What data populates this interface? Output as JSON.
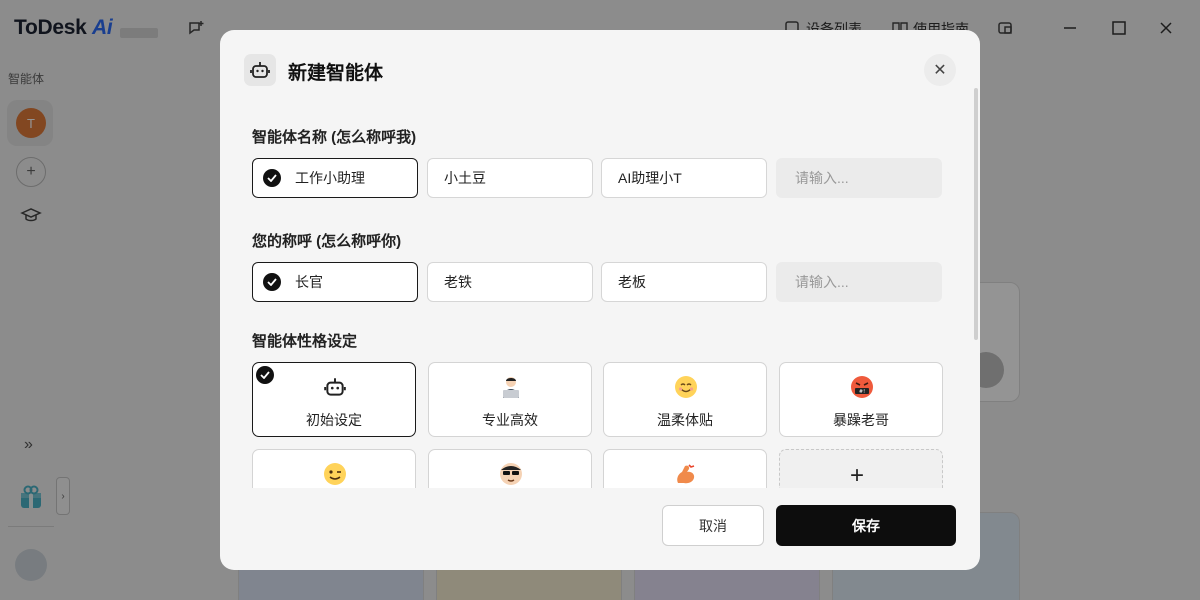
{
  "app": {
    "logo_main": "ToDesk",
    "logo_ai": "Ai",
    "header": {
      "device_list_label": "设备列表",
      "guide_label": "使用指南"
    },
    "sidebar": {
      "section_label": "智能体",
      "active_avatar_letter": "T"
    }
  },
  "modal": {
    "title": "新建智能体",
    "name_section": {
      "label": "智能体名称 (怎么称呼我)",
      "options": [
        "工作小助理",
        "小土豆",
        "AI助理小T"
      ],
      "selected": "工作小助理",
      "input_placeholder": "请输入..."
    },
    "address_section": {
      "label": "您的称呼 (怎么称呼你)",
      "options": [
        "长官",
        "老铁",
        "老板"
      ],
      "selected": "长官",
      "input_placeholder": "请输入..."
    },
    "personality_section": {
      "label": "智能体性格设定",
      "options": [
        {
          "label": "初始设定",
          "icon": "robot-icon"
        },
        {
          "label": "专业高效",
          "icon": "laptop-person-icon"
        },
        {
          "label": "温柔体贴",
          "icon": "smiling-face-icon"
        },
        {
          "label": "暴躁老哥",
          "icon": "cursing-face-icon"
        }
      ],
      "row2_icons": [
        "winking-face-icon",
        "sunglasses-face-icon",
        "flexed-biceps-icon"
      ],
      "selected": "初始设定",
      "add_label": "+"
    },
    "cancel_label": "取消",
    "save_label": "保存"
  },
  "colors": {
    "primary_button": "#0d0d0d",
    "avatar": "#e07a3a",
    "logo_ai": "#2b6cf6",
    "overlay": "rgba(0,0,0,0.42)"
  }
}
